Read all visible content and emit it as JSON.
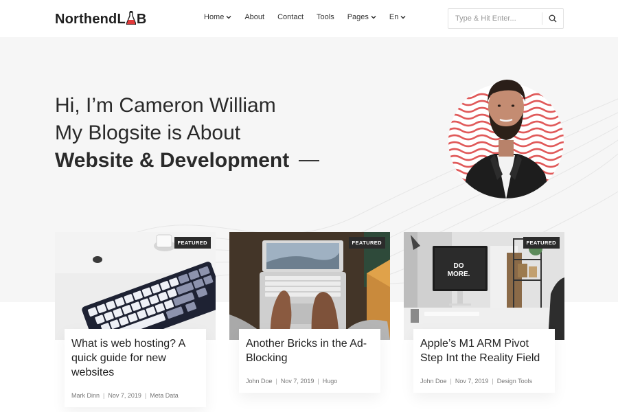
{
  "header": {
    "logo": {
      "part1": "Northend",
      "part2": "L",
      "part3": "B"
    },
    "nav": [
      {
        "label": "Home",
        "dropdown": true
      },
      {
        "label": "About",
        "dropdown": false
      },
      {
        "label": "Contact",
        "dropdown": false
      },
      {
        "label": "Tools",
        "dropdown": false
      },
      {
        "label": "Pages",
        "dropdown": true
      },
      {
        "label": "En",
        "dropdown": true
      }
    ],
    "search": {
      "placeholder": "Type & Hit Enter...",
      "icon": "search-icon"
    }
  },
  "hero": {
    "line1": "Hi, I’m Cameron William",
    "line2": "My Blogsite is About",
    "line3": "Website & Development"
  },
  "cards": [
    {
      "badge": "FEATURED",
      "title": "What is web hosting? A quick guide for new websites",
      "author": "Mark Dinn",
      "date": "Nov 7, 2019",
      "category": "Meta Data"
    },
    {
      "badge": "FEATURED",
      "title": "Another Bricks in the Ad-Blocking",
      "author": "John Doe",
      "date": "Nov 7, 2019",
      "category": "Hugo"
    },
    {
      "badge": "FEATURED",
      "title": "Apple’s M1 ARM Pivot Step Int the Reality Field",
      "author": "John Doe",
      "date": "Nov 7, 2019",
      "category": "Design Tools",
      "screen_text_1": "DO",
      "screen_text_2": "MORE."
    }
  ],
  "colors": {
    "accent": "#e23a3a",
    "hero_bg": "#f6f6f6",
    "badge_bg": "#2b2b2b"
  }
}
